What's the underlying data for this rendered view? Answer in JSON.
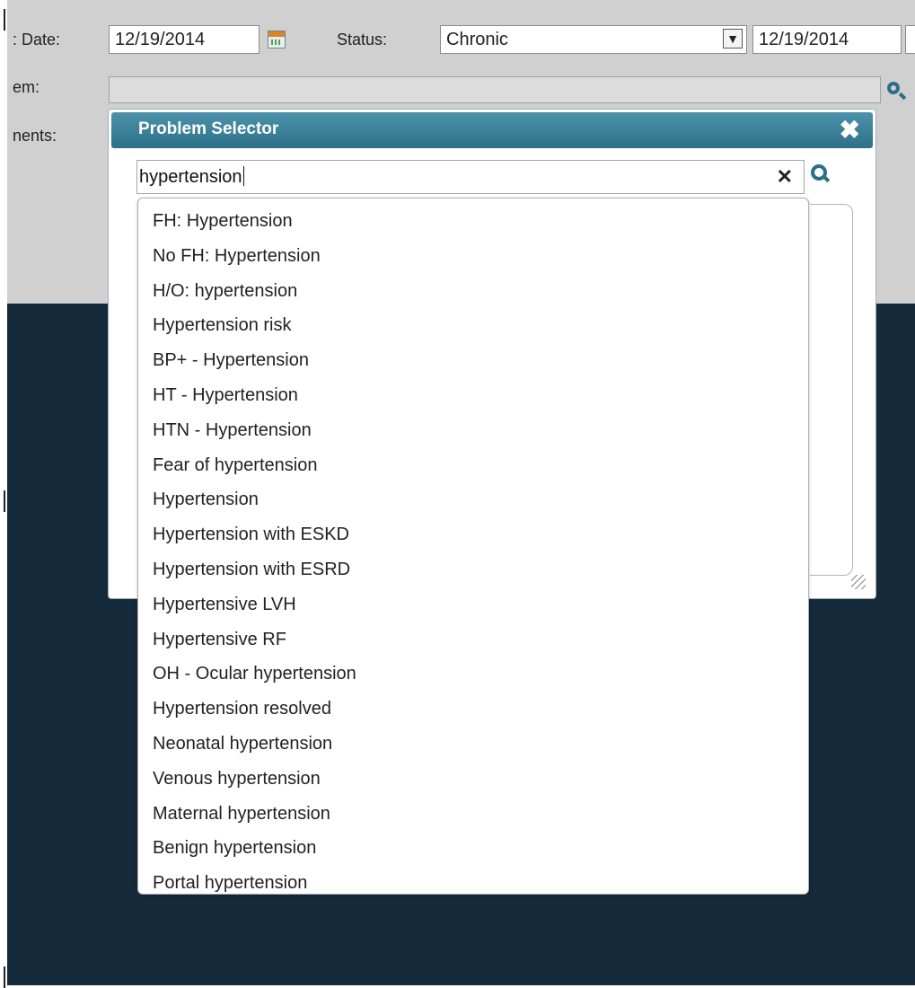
{
  "form": {
    "date_label": ": Date:",
    "date_value": "12/19/2014",
    "status_label": "Status:",
    "status_value": "Chronic",
    "end_date_value": "12/19/2014",
    "problem_label": "em:",
    "problem_value": "",
    "comments_label": "nents:"
  },
  "dialog": {
    "title": "Problem Selector",
    "close_symbol": "✖",
    "search_value": "hypertension",
    "clear_symbol": "✕"
  },
  "results": [
    "FH: Hypertension",
    "No FH: Hypertension",
    "H/O: hypertension",
    "Hypertension risk",
    "BP+ - Hypertension",
    "HT - Hypertension",
    "HTN - Hypertension",
    "Fear of hypertension",
    "Hypertension",
    "Hypertension with ESKD",
    "Hypertension with ESRD",
    "Hypertensive LVH",
    "Hypertensive RF",
    "OH - Ocular hypertension",
    "Hypertension resolved",
    "Neonatal hypertension",
    "Venous hypertension",
    "Maternal hypertension",
    "Benign hypertension",
    "Portal hypertension"
  ],
  "icons": {
    "calendar": "calendar-icon",
    "search": "search-icon",
    "dropdown_arrow": "chevron-down-icon",
    "close": "close-icon",
    "clear": "clear-icon",
    "resize": "resize-grip-icon"
  },
  "colors": {
    "titlebar": "#2d7189",
    "dark_background": "#152a3a",
    "form_background": "#d0d0d0",
    "accent": "#2b6f87"
  }
}
